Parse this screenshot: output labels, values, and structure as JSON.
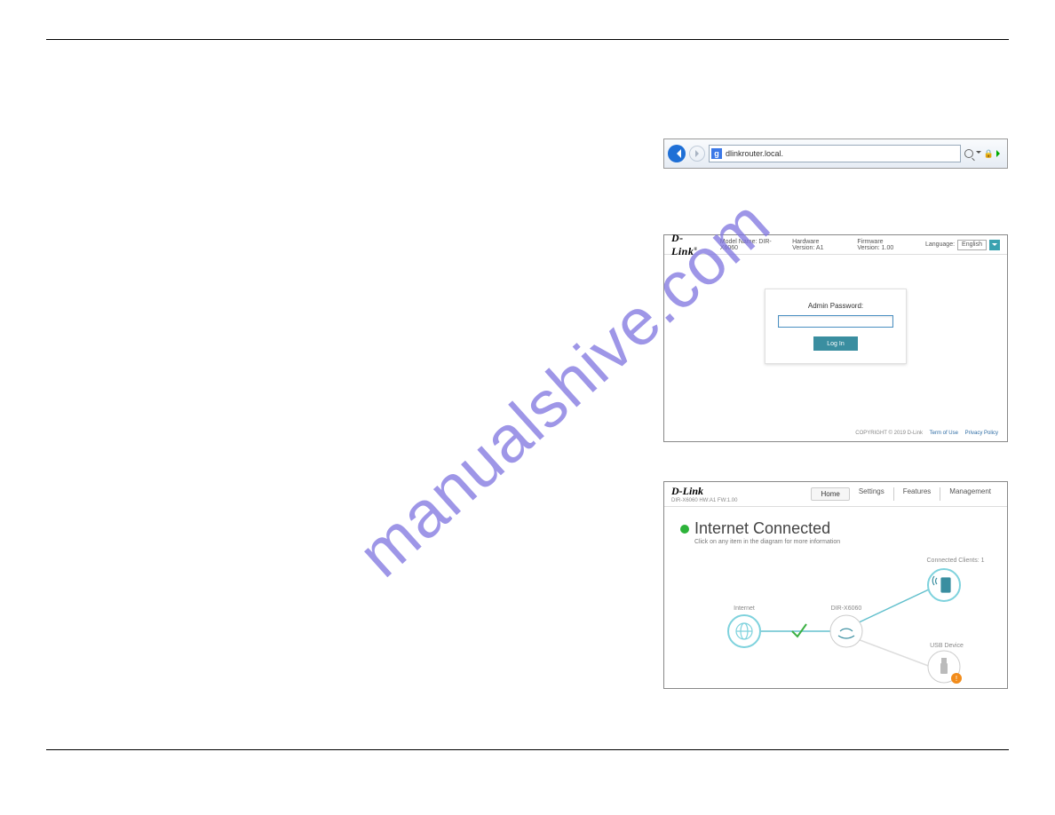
{
  "watermark": "manualshive.com",
  "addressBar": {
    "url": "dlinkrouter.local.",
    "searchEngineGlyph": "g"
  },
  "login": {
    "brand": "D-Link",
    "modelLabel": "Model Name: DIR-X6060",
    "hwLabel": "Hardware Version: A1",
    "fwLabel": "Firmware Version: 1.00",
    "languageLabel": "Language:",
    "languageValue": "English",
    "passwordLabel": "Admin Password:",
    "loginButton": "Log In",
    "copyright": "COPYRIGHT © 2019 D-Link",
    "terms": "Term of Use",
    "privacy": "Privacy Policy"
  },
  "dashboard": {
    "brand": "D-Link",
    "sub": "DIR-X6060 HW:A1 FW:1.00",
    "tabs": {
      "home": "Home",
      "settings": "Settings",
      "features": "Features",
      "management": "Management"
    },
    "statusTitle": "Internet Connected",
    "statusHint": "Click on any item in the diagram for more information",
    "node": {
      "internet": "Internet",
      "router": "DIR-X6060",
      "clients": "Connected Clients: 1",
      "usb": "USB Device"
    }
  }
}
